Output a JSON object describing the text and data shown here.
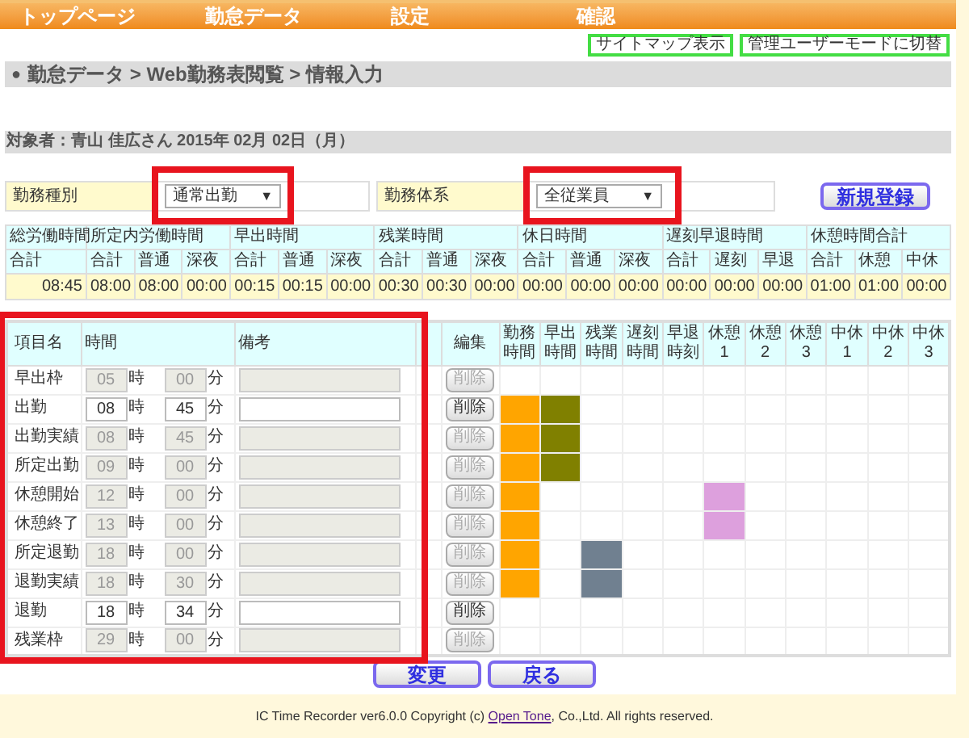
{
  "nav": [
    "トップページ",
    "勤怠データ",
    "設定",
    "確認"
  ],
  "top_buttons": [
    "サイトマップ表示",
    "管理ユーザーモードに切替"
  ],
  "breadcrumb": {
    "bullet": "●",
    "path": "勤怠データ > Web勤務表閲覧 > 情報入力"
  },
  "target": "対象者：青山 佳広さん 2015年 02月 02日（月）",
  "form": {
    "fields": [
      {
        "label": "勤務種別",
        "value": "通常出勤",
        "arrow": "▼",
        "highlighted": true
      },
      {
        "label": "勤務体系",
        "value": "全従業員",
        "arrow": "▼",
        "highlighted": true
      }
    ],
    "button": "新規登録"
  },
  "summary": {
    "groups": [
      "総労働時間",
      "所定内労働時間",
      "早出時間",
      "残業時間",
      "休日時間",
      "遅刻早退時間",
      "休憩時間合計"
    ],
    "subheads": [
      "合計",
      "合計",
      "普通",
      "深夜",
      "合計",
      "普通",
      "深夜",
      "合計",
      "普通",
      "深夜",
      "合計",
      "普通",
      "深夜",
      "合計",
      "遅刻",
      "早退",
      "合計",
      "休憩",
      "中休"
    ],
    "values": [
      "08:45",
      "08:00",
      "08:00",
      "00:00",
      "00:15",
      "00:15",
      "00:00",
      "00:30",
      "00:30",
      "00:00",
      "00:00",
      "00:00",
      "00:00",
      "00:00",
      "00:00",
      "00:00",
      "01:00",
      "01:00",
      "00:00"
    ]
  },
  "detail": {
    "highlighted": true,
    "columns": [
      "項目名",
      "時間",
      "備考",
      "編集"
    ],
    "timeline_columns": [
      "勤務時間",
      "早出時間",
      "残業時間",
      "遅刻時間",
      "早退時刻",
      "休憩1",
      "休憩2",
      "休憩3",
      "中休1",
      "中休2",
      "中休3"
    ],
    "rows": [
      {
        "name": "早出枠",
        "hour": "05",
        "hour_unit": "時",
        "minute": "00",
        "minute_unit": "分",
        "disabled": true,
        "delete": "削除",
        "timeline": [
          {
            "filled": false
          },
          {
            "filled": false
          },
          {
            "filled": false
          },
          {
            "filled": false
          },
          {
            "filled": false
          },
          {
            "filled": false
          },
          {
            "filled": false
          },
          {
            "filled": false
          },
          {
            "filled": false
          },
          {
            "filled": false
          },
          {
            "filled": false
          }
        ]
      },
      {
        "name": "出勤",
        "hour": "08",
        "hour_unit": "時",
        "minute": "45",
        "minute_unit": "分",
        "disabled": false,
        "delete": "削除",
        "timeline": [
          {
            "filled": true,
            "color": "#ffa500"
          },
          {
            "filled": true,
            "color": "#808000"
          },
          {
            "filled": false
          },
          {
            "filled": false
          },
          {
            "filled": false
          },
          {
            "filled": false
          },
          {
            "filled": false
          },
          {
            "filled": false
          },
          {
            "filled": false
          },
          {
            "filled": false
          },
          {
            "filled": false
          }
        ]
      },
      {
        "name": "出勤実績",
        "hour": "08",
        "hour_unit": "時",
        "minute": "45",
        "minute_unit": "分",
        "disabled": true,
        "delete": "削除",
        "timeline": [
          {
            "filled": true,
            "color": "#ffa500"
          },
          {
            "filled": true,
            "color": "#808000"
          },
          {
            "filled": false
          },
          {
            "filled": false
          },
          {
            "filled": false
          },
          {
            "filled": false
          },
          {
            "filled": false
          },
          {
            "filled": false
          },
          {
            "filled": false
          },
          {
            "filled": false
          },
          {
            "filled": false
          }
        ]
      },
      {
        "name": "所定出勤",
        "hour": "09",
        "hour_unit": "時",
        "minute": "00",
        "minute_unit": "分",
        "disabled": true,
        "delete": "削除",
        "timeline": [
          {
            "filled": true,
            "color": "#ffa500"
          },
          {
            "filled": true,
            "color": "#808000"
          },
          {
            "filled": false
          },
          {
            "filled": false
          },
          {
            "filled": false
          },
          {
            "filled": false
          },
          {
            "filled": false
          },
          {
            "filled": false
          },
          {
            "filled": false
          },
          {
            "filled": false
          },
          {
            "filled": false
          }
        ]
      },
      {
        "name": "休憩開始",
        "hour": "12",
        "hour_unit": "時",
        "minute": "00",
        "minute_unit": "分",
        "disabled": true,
        "delete": "削除",
        "timeline": [
          {
            "filled": true,
            "color": "#ffa500"
          },
          {
            "filled": false
          },
          {
            "filled": false
          },
          {
            "filled": false
          },
          {
            "filled": false
          },
          {
            "filled": true,
            "color": "#dda0dd"
          },
          {
            "filled": false
          },
          {
            "filled": false
          },
          {
            "filled": false
          },
          {
            "filled": false
          },
          {
            "filled": false
          }
        ]
      },
      {
        "name": "休憩終了",
        "hour": "13",
        "hour_unit": "時",
        "minute": "00",
        "minute_unit": "分",
        "disabled": true,
        "delete": "削除",
        "timeline": [
          {
            "filled": true,
            "color": "#ffa500"
          },
          {
            "filled": false
          },
          {
            "filled": false
          },
          {
            "filled": false
          },
          {
            "filled": false
          },
          {
            "filled": true,
            "color": "#dda0dd"
          },
          {
            "filled": false
          },
          {
            "filled": false
          },
          {
            "filled": false
          },
          {
            "filled": false
          },
          {
            "filled": false
          }
        ]
      },
      {
        "name": "所定退勤",
        "hour": "18",
        "hour_unit": "時",
        "minute": "00",
        "minute_unit": "分",
        "disabled": true,
        "delete": "削除",
        "timeline": [
          {
            "filled": true,
            "color": "#ffa500"
          },
          {
            "filled": false
          },
          {
            "filled": true,
            "color": "#708090"
          },
          {
            "filled": false
          },
          {
            "filled": false
          },
          {
            "filled": false
          },
          {
            "filled": false
          },
          {
            "filled": false
          },
          {
            "filled": false
          },
          {
            "filled": false
          },
          {
            "filled": false
          }
        ]
      },
      {
        "name": "退勤実績",
        "hour": "18",
        "hour_unit": "時",
        "minute": "30",
        "minute_unit": "分",
        "disabled": true,
        "delete": "削除",
        "timeline": [
          {
            "filled": true,
            "color": "#ffa500"
          },
          {
            "filled": false
          },
          {
            "filled": true,
            "color": "#708090"
          },
          {
            "filled": false
          },
          {
            "filled": false
          },
          {
            "filled": false
          },
          {
            "filled": false
          },
          {
            "filled": false
          },
          {
            "filled": false
          },
          {
            "filled": false
          },
          {
            "filled": false
          }
        ]
      },
      {
        "name": "退勤",
        "hour": "18",
        "hour_unit": "時",
        "minute": "34",
        "minute_unit": "分",
        "disabled": false,
        "delete": "削除",
        "timeline": [
          {
            "filled": false
          },
          {
            "filled": false
          },
          {
            "filled": false
          },
          {
            "filled": false
          },
          {
            "filled": false
          },
          {
            "filled": false
          },
          {
            "filled": false
          },
          {
            "filled": false
          },
          {
            "filled": false
          },
          {
            "filled": false
          },
          {
            "filled": false
          }
        ]
      },
      {
        "name": "残業枠",
        "hour": "29",
        "hour_unit": "時",
        "minute": "00",
        "minute_unit": "分",
        "disabled": true,
        "delete": "削除",
        "timeline": [
          {
            "filled": false
          },
          {
            "filled": false
          },
          {
            "filled": false
          },
          {
            "filled": false
          },
          {
            "filled": false
          },
          {
            "filled": false
          },
          {
            "filled": false
          },
          {
            "filled": false
          },
          {
            "filled": false
          },
          {
            "filled": false
          },
          {
            "filled": false
          }
        ]
      }
    ]
  },
  "bottom_buttons": [
    "変更",
    "戻る"
  ],
  "footer": {
    "before": "IC Time Recorder ver6.0.0 Copyright (c) ",
    "link": "Open Tone",
    "after": ", Co.,Ltd. All rights reserved."
  }
}
